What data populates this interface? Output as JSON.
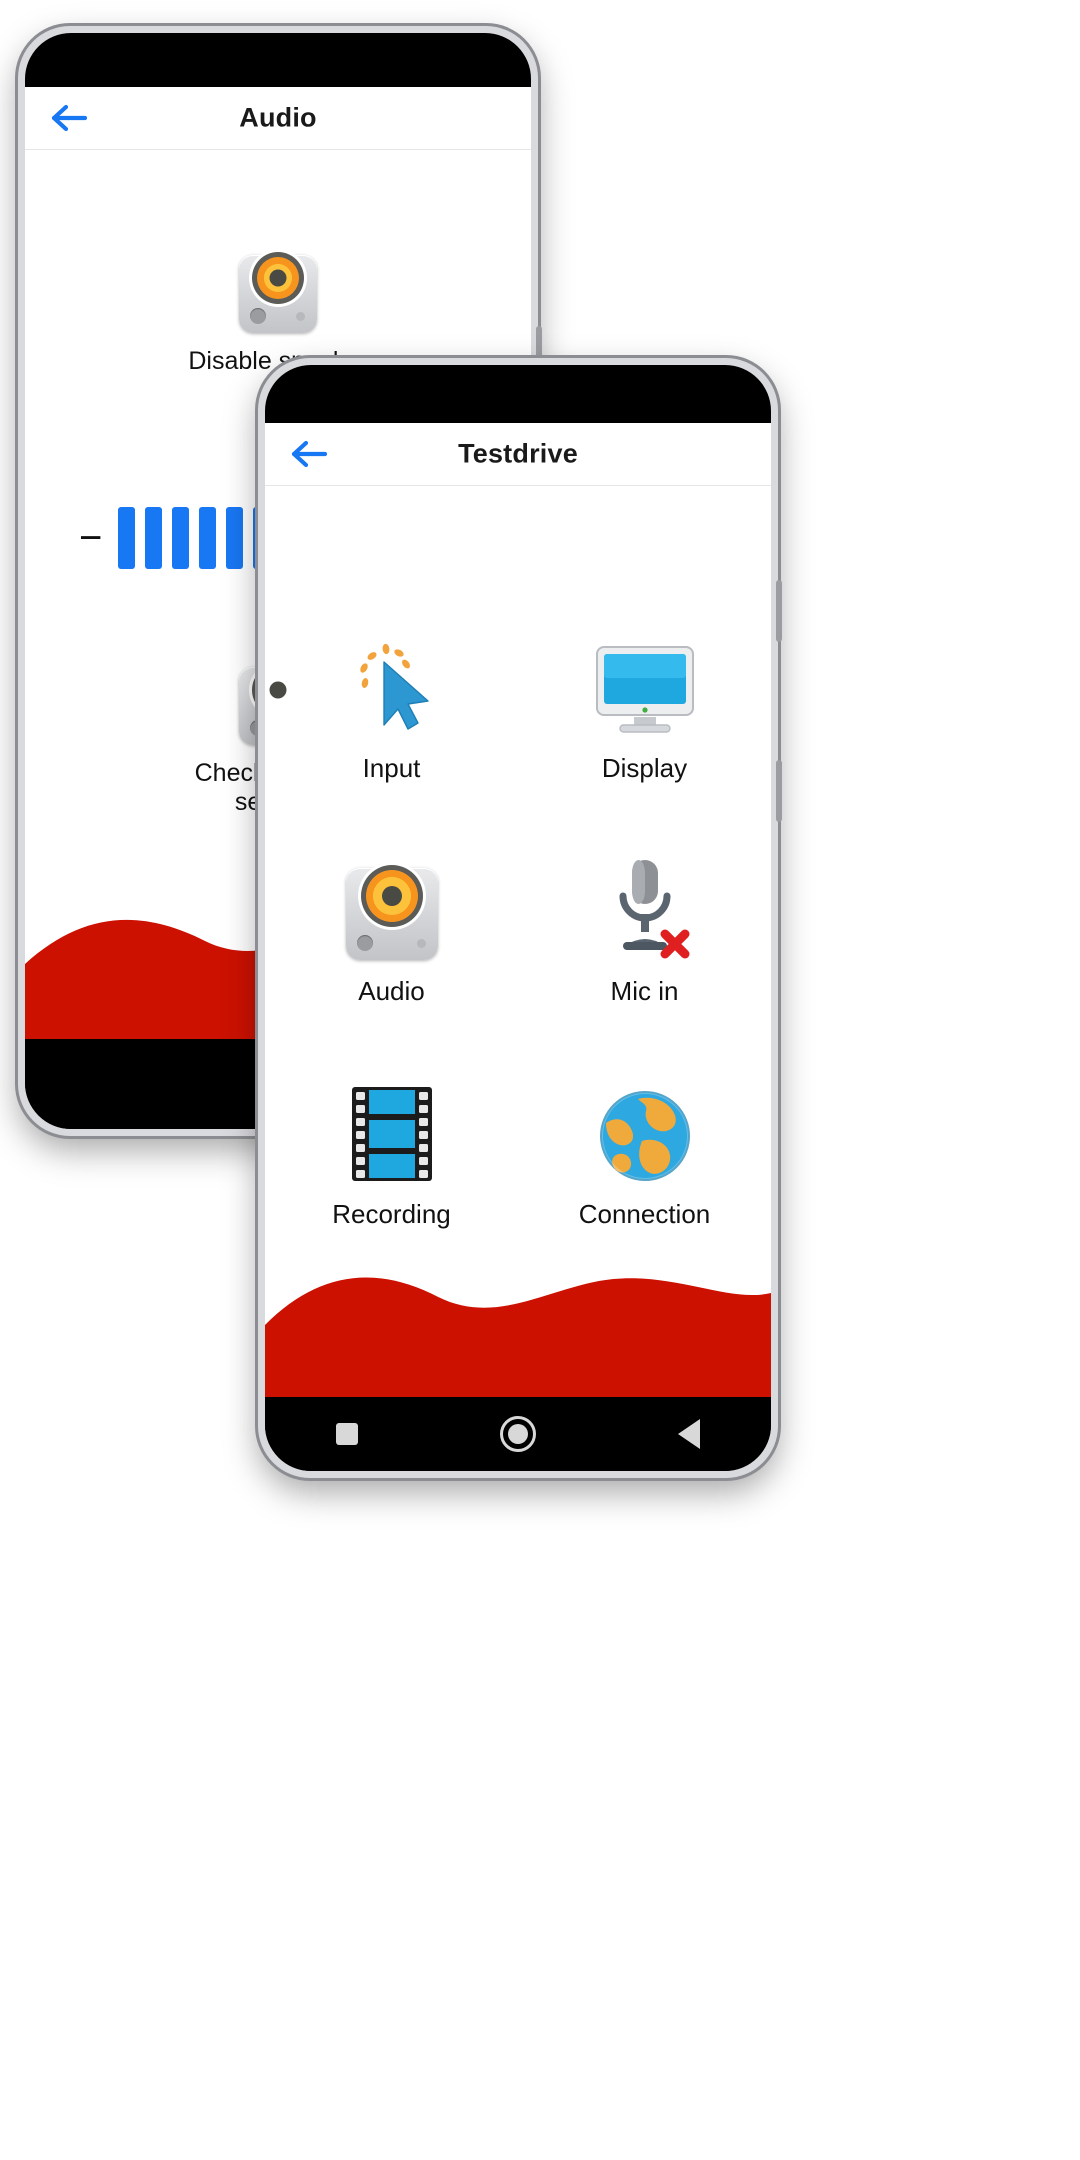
{
  "back_phone": {
    "appbar": {
      "title": "Audio",
      "back_icon": "arrow-left-icon"
    },
    "items": [
      {
        "label": "Disable speaker",
        "icon": "speaker-icon"
      },
      {
        "label": "Check speaker settings",
        "icon": "speaker-icon"
      }
    ],
    "volume": {
      "minus_label": "−",
      "bars_filled": 8,
      "bar_color": "#1877F2"
    }
  },
  "front_phone": {
    "appbar": {
      "title": "Testdrive",
      "back_icon": "arrow-left-icon"
    },
    "tiles": [
      {
        "label": "Input",
        "icon": "cursor-click-icon"
      },
      {
        "label": "Display",
        "icon": "monitor-icon"
      },
      {
        "label": "Audio",
        "icon": "speaker-icon"
      },
      {
        "label": "Mic in",
        "icon": "microphone-disabled-icon"
      },
      {
        "label": "Recording",
        "icon": "film-strip-icon"
      },
      {
        "label": "Connection",
        "icon": "globe-icon"
      }
    ],
    "navbar": {
      "recents_icon": "square-icon",
      "home_icon": "circle-icon",
      "back_icon": "triangle-back-icon"
    }
  },
  "theme": {
    "accent_blue": "#1877F2",
    "wave_red": "#CC1100",
    "wave_red_dark": "#B30E00",
    "text": "#111111"
  }
}
